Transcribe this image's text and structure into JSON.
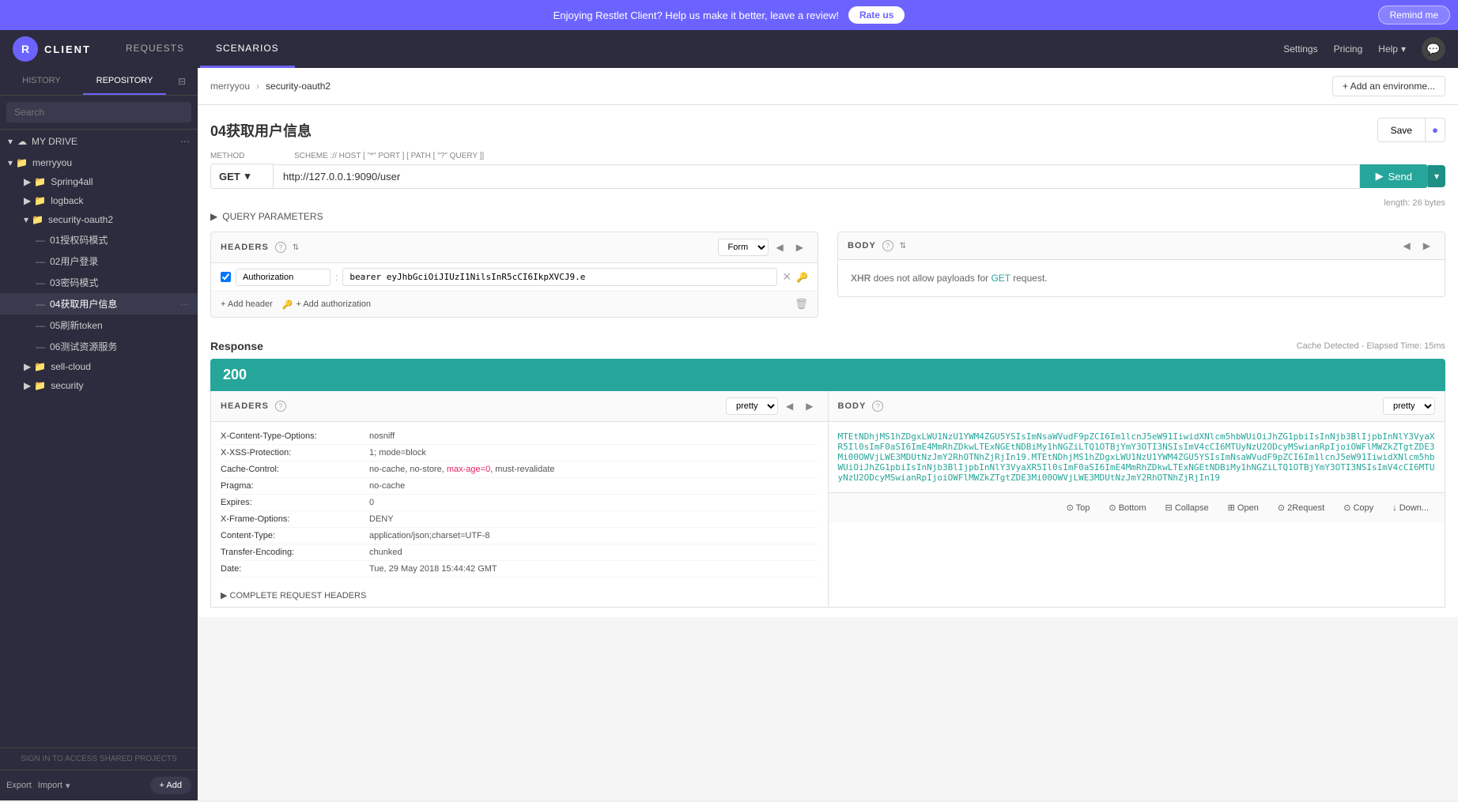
{
  "banner": {
    "message": "Enjoying Restlet Client? Help us make it better, leave a review!",
    "rate_label": "Rate us",
    "remind_label": "Remind me"
  },
  "header": {
    "app_initial": "R",
    "app_name": "CLIENT",
    "nav": [
      {
        "id": "requests",
        "label": "REQUESTS",
        "active": false
      },
      {
        "id": "scenarios",
        "label": "SCENARIOS",
        "active": false
      }
    ],
    "settings_label": "Settings",
    "pricing_label": "Pricing",
    "help_label": "Help"
  },
  "sidebar": {
    "tabs": [
      {
        "id": "history",
        "label": "HISTORY",
        "active": false
      },
      {
        "id": "repository",
        "label": "REPOSITORY",
        "active": true
      }
    ],
    "search_placeholder": "Search",
    "my_drive_label": "MY DRIVE",
    "tree": [
      {
        "label": "merryyou",
        "type": "folder",
        "expanded": true,
        "children": [
          {
            "label": "Spring4all",
            "type": "folder"
          },
          {
            "label": "logback",
            "type": "folder"
          },
          {
            "label": "security-oauth2",
            "type": "folder",
            "expanded": true,
            "children": [
              {
                "label": "01授权码模式",
                "type": "request"
              },
              {
                "label": "02用户登录",
                "type": "request"
              },
              {
                "label": "03密码模式",
                "type": "request"
              },
              {
                "label": "04获取用户信息",
                "type": "request",
                "active": true
              },
              {
                "label": "05刷新token",
                "type": "request"
              },
              {
                "label": "06测试资源服务",
                "type": "request"
              }
            ]
          },
          {
            "label": "sell-cloud",
            "type": "folder"
          },
          {
            "label": "security",
            "type": "folder"
          }
        ]
      }
    ],
    "sign_in_label": "SIGN IN TO ACCESS SHARED PROJECTS",
    "export_label": "Export",
    "import_label": "Import",
    "add_label": "+ Add"
  },
  "breadcrumb": {
    "items": [
      "merryyou",
      "security-oauth2"
    ],
    "separator": "›",
    "add_env_label": "+ Add an environme..."
  },
  "request": {
    "title": "04获取用户信息",
    "save_label": "Save",
    "method_label": "METHOD",
    "method": "GET",
    "url_label": "SCHEME :// HOST [ \"*\" PORT ] [ PATH [ \"?\" QUERY ]]",
    "url": "http://127.0.0.1:9090/user",
    "length_info": "length: 26 bytes",
    "send_label": "Send",
    "query_params_label": "QUERY PARAMETERS",
    "headers_section": {
      "title": "HEADERS",
      "form_label": "Form",
      "nav_prev": "◀",
      "nav_next": "▶",
      "rows": [
        {
          "checked": true,
          "key": "Authorization",
          "value": "bearer eyJhbGciOiJIUzI1NilsInR5cCI6IkpXVCJ9.e"
        }
      ],
      "add_header_label": "+ Add header",
      "add_auth_label": "+ Add authorization"
    },
    "body_section": {
      "title": "BODY",
      "nav_prev": "◀",
      "nav_next": "▶",
      "message": "XHR does not allow payloads for GET request."
    }
  },
  "response": {
    "title": "Response",
    "cache_info": "Cache Detected - Elapsed Time: 15ms",
    "status_code": "200",
    "headers_section": {
      "title": "HEADERS",
      "pretty_label": "pretty",
      "nav_prev": "◀",
      "nav_next": "▶",
      "rows": [
        {
          "key": "X-Content-Type-Options:",
          "value": "nosniff"
        },
        {
          "key": "X-XSS-Protection:",
          "value": "1; mode=block"
        },
        {
          "key": "Cache-Control:",
          "value": "no-cache, no-store, max-age=0, must-revalidate",
          "highlight": "max-age=0"
        },
        {
          "key": "Pragma:",
          "value": "no-cache"
        },
        {
          "key": "Expires:",
          "value": "0"
        },
        {
          "key": "X-Frame-Options:",
          "value": "DENY"
        },
        {
          "key": "Content-Type:",
          "value": "application/json;charset=UTF-8"
        },
        {
          "key": "Transfer-Encoding:",
          "value": "chunked"
        },
        {
          "key": "Date:",
          "value": "Tue, 29 May 2018 15:44:42 GMT"
        }
      ],
      "complete_headers_label": "▶ COMPLETE REQUEST HEADERS"
    },
    "body_section": {
      "title": "BODY",
      "pretty_label": "pretty",
      "content": "MTEtNDhjMS1hZDgxLWU1NzU1YWM4ZGU5YSIsImNsaWVudF9pZCI6Im1lcnJ5eW91IiwidXNlcm5hbWUiOiJhZG1pbiIsInNjb3BlIjpbInNlY3VyaXR5Il0sImF0aSI6ImE4MmRhZDkwLTExNGEtNDBiMy1hNGZiLTQ1OTBjYmY3OTI3NSIsImV4cCI6MTUyNzU2ODcyMSwianRpIjoiOWFlMWZkZTgtZDE3Mi00OWVjLWE3MDUtNzJmY2RhOTNhZjRjIn19.MTEtNDhjMS1hZDgxLWU1NzU1YWM4ZGU5YSIsImNsaWVudF9pZCI6Im1lcnJ5eW91IiwidXNlcm5hbWUiOiJhZG1pbiIsInNjb3BlIjpbInNlY3VyaXR5Il0sImF0aSI6ImE4MmRhZDkwLTExNGEtNDBiMy1hNGZiLTQ1OTBjYmY3OTI3NSIsImV4cCI6MTUyNzU2ODcyMSwianRpIjoiOWFlMWZkZTgtZDE3Mi00OWVjLWE3MDUtNzJmY2RhOTNhZjRjIn19"
    },
    "actions": {
      "top_label": "⊙ Top",
      "bottom_label": "⊙ Bottom",
      "collapse_label": "⊟ Collapse",
      "open_label": "⊞ Open",
      "request_label": "⊙ 2Request",
      "copy_label": "⊙ Copy",
      "down_label": "↓ Down..."
    }
  }
}
